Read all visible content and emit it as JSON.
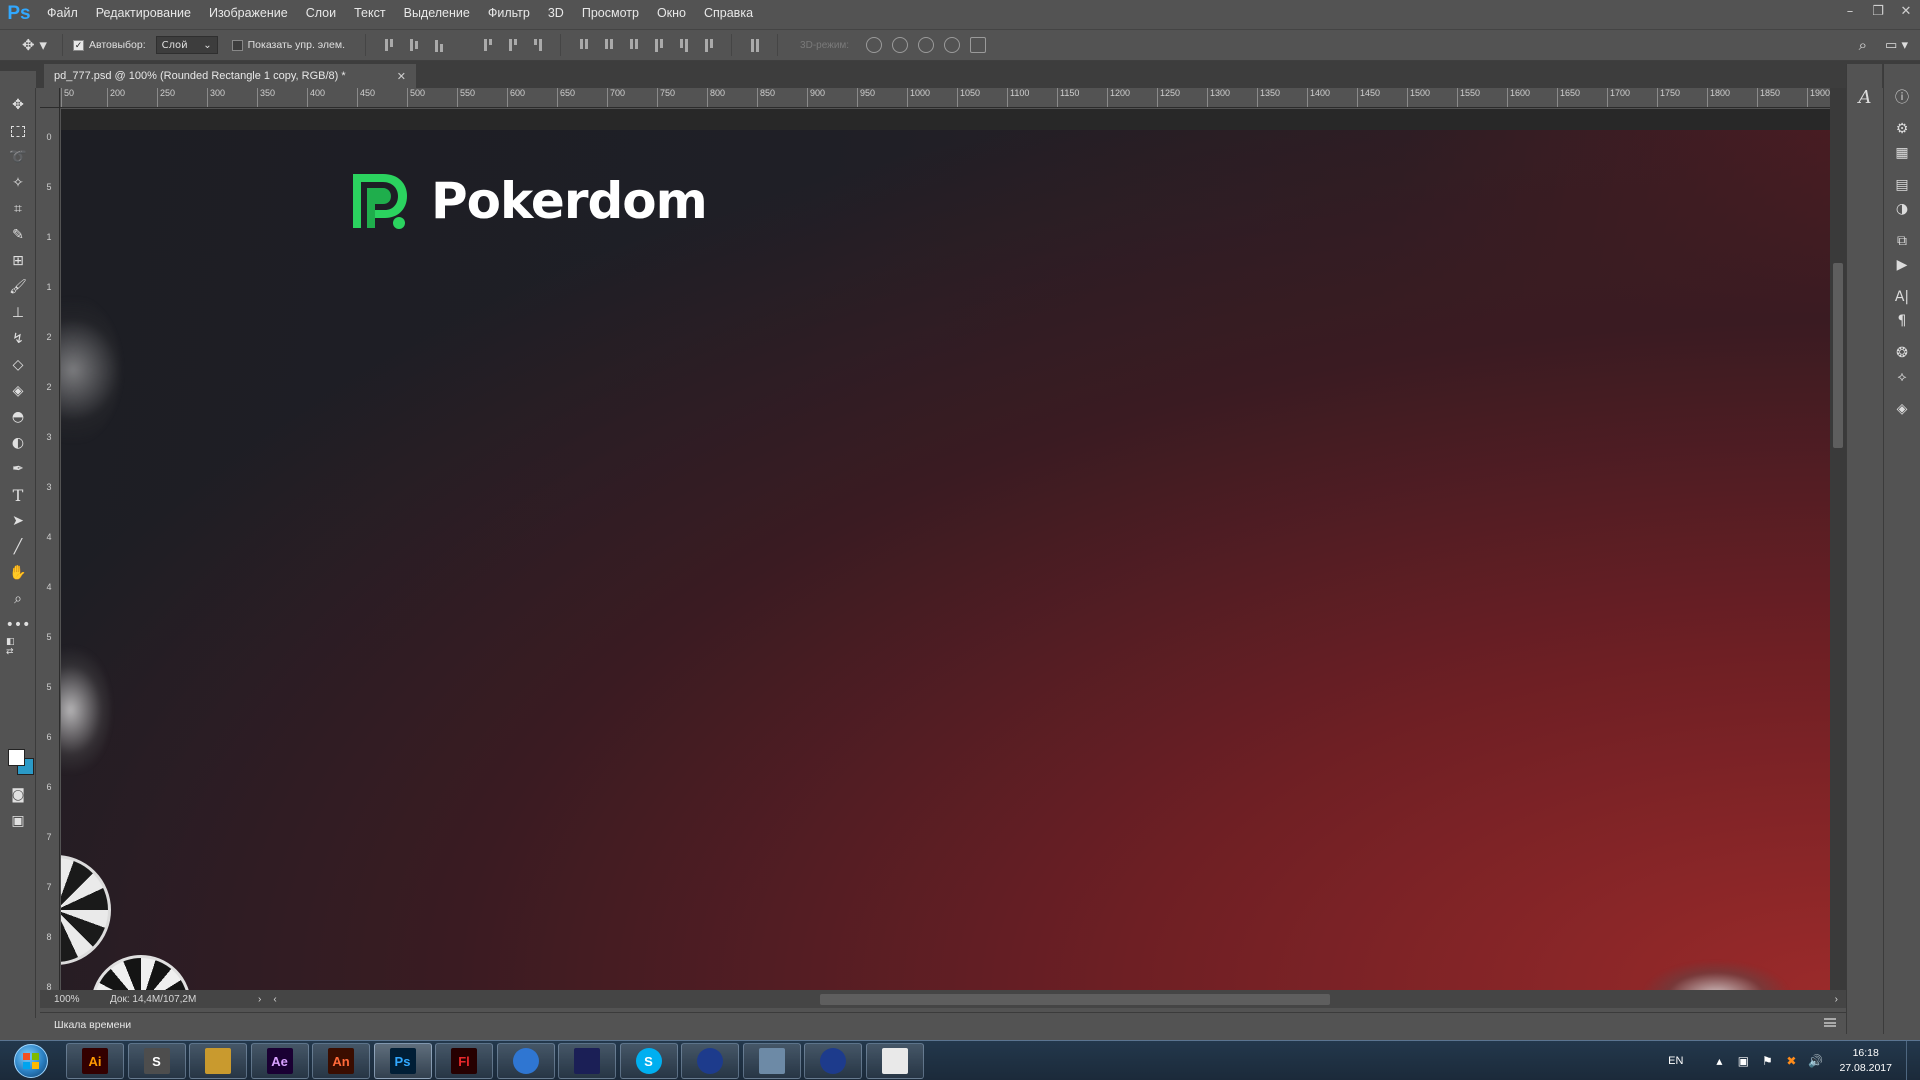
{
  "app": {
    "logo": "Ps",
    "menu": [
      "Файл",
      "Редактирование",
      "Изображение",
      "Слои",
      "Текст",
      "Выделение",
      "Фильтр",
      "3D",
      "Просмотр",
      "Окно",
      "Справка"
    ],
    "window_controls": [
      "minimize-icon",
      "restore-icon",
      "close-icon"
    ]
  },
  "options_bar": {
    "autoselect_label": "Автовыбор:",
    "autoselect_checked": true,
    "autoselect_target": "Слой",
    "show_transform_label": "Показать упр. элем.",
    "show_transform_checked": false,
    "mode_3d_label": "3D-режим:"
  },
  "document": {
    "tab_title": "pd_777.psd @ 100% (Rounded Rectangle 1 copy, RGB/8) *",
    "zoom": "100%",
    "doc_size": "Док: 14,4M/107,2M"
  },
  "ruler": {
    "top_labels": [
      "50",
      "200",
      "250",
      "300",
      "350",
      "400",
      "450",
      "500",
      "550",
      "600",
      "650",
      "700",
      "750",
      "800",
      "850",
      "900",
      "950",
      "1000",
      "1050",
      "1100",
      "1150",
      "1200",
      "1250",
      "1300",
      "1350",
      "1400",
      "1450",
      "1500",
      "1550",
      "1600",
      "1650",
      "1700",
      "1750",
      "1800",
      "1850",
      "1900"
    ],
    "left_labels": [
      "0",
      "5",
      "1",
      "1",
      "2",
      "2",
      "3",
      "3",
      "4",
      "4",
      "5",
      "5",
      "6",
      "6",
      "7",
      "7",
      "8",
      "8"
    ]
  },
  "artwork": {
    "brand_name": "Pokerdom",
    "brand_color": "#2bd35f",
    "bg_dark": "#1e1f25",
    "bg_red": "#a02a2a"
  },
  "timeline": {
    "label": "Шкала времени"
  },
  "taskbar": {
    "apps": [
      {
        "name": "illustrator",
        "label": "Ai",
        "color": "#ff9a00",
        "bg": "#330000"
      },
      {
        "name": "sublime",
        "label": "S",
        "color": "#ffffff",
        "bg": "#4d4d4d"
      },
      {
        "name": "explorer",
        "label": "",
        "color": "#f5d16b",
        "bg": "#c99a2e"
      },
      {
        "name": "after-effects",
        "label": "Ae",
        "color": "#d8a1ff",
        "bg": "#1a0033"
      },
      {
        "name": "animate",
        "label": "An",
        "color": "#ff6a3a",
        "bg": "#3a0d00"
      },
      {
        "name": "photoshop",
        "label": "Ps",
        "color": "#31a8ff",
        "bg": "#001e36"
      },
      {
        "name": "flash",
        "label": "Fl",
        "color": "#e8282b",
        "bg": "#260000"
      },
      {
        "name": "app-circle",
        "label": "",
        "color": "#ffffff",
        "bg": "#2f76d2"
      },
      {
        "name": "premiere-gen",
        "label": "",
        "color": "#ffffff",
        "bg": "#1b1f56"
      },
      {
        "name": "skype",
        "label": "S",
        "color": "#ffffff",
        "bg": "#00aff0"
      },
      {
        "name": "firefox",
        "label": "",
        "color": "#ff7e1a",
        "bg": "#1d3b8c"
      },
      {
        "name": "calculator",
        "label": "",
        "color": "#cfe3f5",
        "bg": "#6d8aa6"
      },
      {
        "name": "firefox-2",
        "label": "",
        "color": "#ff7e1a",
        "bg": "#1d3b8c"
      },
      {
        "name": "notepad",
        "label": "",
        "color": "#ffffff",
        "bg": "#e9e9e9"
      }
    ],
    "lang": "EN",
    "time": "16:18",
    "date": "27.08.2017"
  }
}
